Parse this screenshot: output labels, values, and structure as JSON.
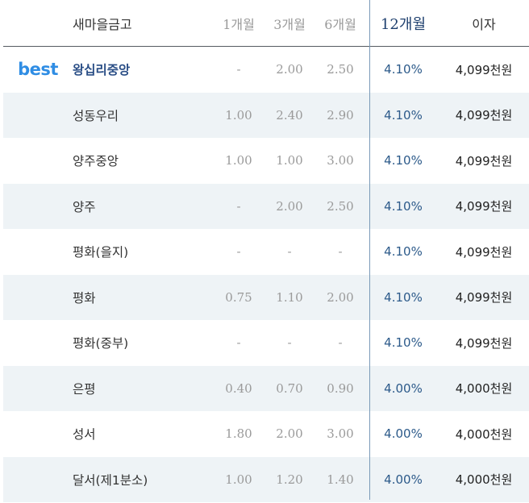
{
  "header": {
    "name": "새마을금고",
    "m1": "1개월",
    "m3": "3개월",
    "m6": "6개월",
    "m12": "12개월",
    "interest": "이자"
  },
  "badge": "best",
  "rows": [
    {
      "name": "왕십리중앙",
      "m1": "-",
      "m3": "2.00",
      "m6": "2.50",
      "m12": "4.10%",
      "interest": "4,099천원"
    },
    {
      "name": "성동우리",
      "m1": "1.00",
      "m3": "2.40",
      "m6": "2.90",
      "m12": "4.10%",
      "interest": "4,099천원"
    },
    {
      "name": "양주중앙",
      "m1": "1.00",
      "m3": "1.00",
      "m6": "3.00",
      "m12": "4.10%",
      "interest": "4,099천원"
    },
    {
      "name": "양주",
      "m1": "-",
      "m3": "2.00",
      "m6": "2.50",
      "m12": "4.10%",
      "interest": "4,099천원"
    },
    {
      "name": "평화(을지)",
      "m1": "-",
      "m3": "-",
      "m6": "-",
      "m12": "4.10%",
      "interest": "4,099천원"
    },
    {
      "name": "평화",
      "m1": "0.75",
      "m3": "1.10",
      "m6": "2.00",
      "m12": "4.10%",
      "interest": "4,099천원"
    },
    {
      "name": "평화(중부)",
      "m1": "-",
      "m3": "-",
      "m6": "-",
      "m12": "4.10%",
      "interest": "4,099천원"
    },
    {
      "name": "은평",
      "m1": "0.40",
      "m3": "0.70",
      "m6": "0.90",
      "m12": "4.00%",
      "interest": "4,000천원"
    },
    {
      "name": "성서",
      "m1": "1.80",
      "m3": "2.00",
      "m6": "3.00",
      "m12": "4.00%",
      "interest": "4,000천원"
    },
    {
      "name": "달서(제1분소)",
      "m1": "1.00",
      "m3": "1.20",
      "m6": "1.40",
      "m12": "4.00%",
      "interest": "4,000천원"
    }
  ],
  "colors": {
    "best_badge": "#2f8de4",
    "best_name": "#2a4e86",
    "rate_12m": "#2c5a8a",
    "row_shade": "#eef3f6",
    "header_rule": "#555a60"
  }
}
